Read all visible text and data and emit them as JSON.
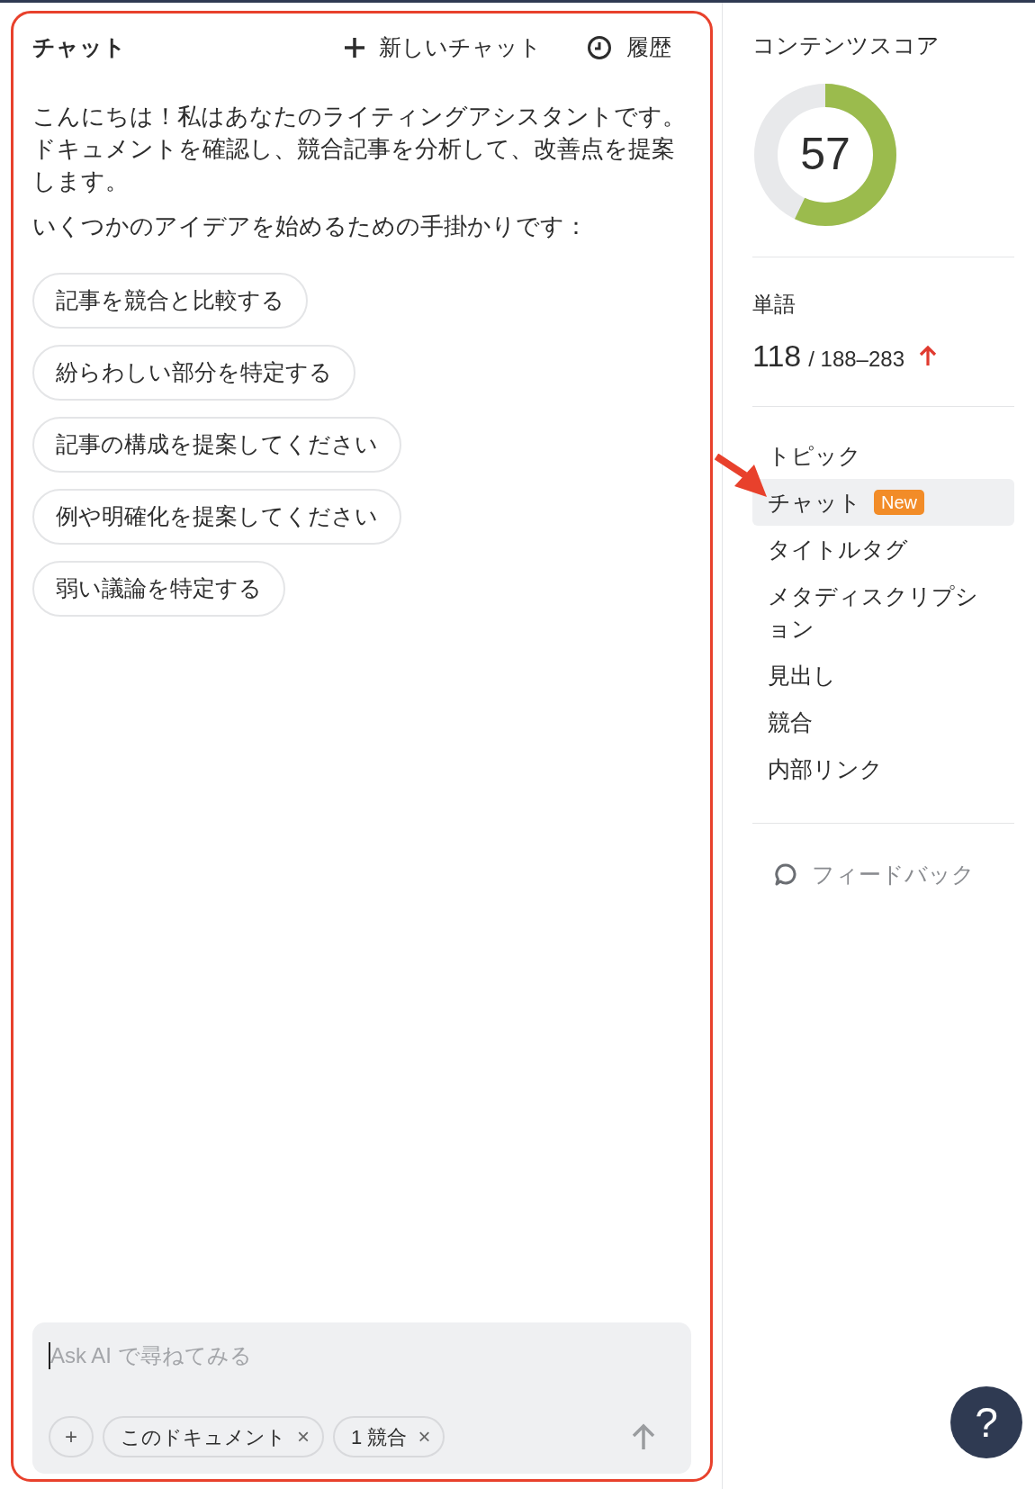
{
  "chat_panel": {
    "title": "チャット",
    "new_chat_button": "新しいチャット",
    "history_button": "履歴",
    "messages": [
      "こんにちは！私はあなたのライティングアシスタントです。ドキュメントを確認し、競合記事を分析して、改善点を提案します。",
      "いくつかのアイデアを始めるための手掛かりです："
    ],
    "suggestions": [
      "記事を競合と比較する",
      "紛らわしい部分を特定する",
      "記事の構成を提案してください",
      "例や明確化を提案してください",
      "弱い議論を特定する"
    ],
    "input": {
      "placeholder": "Ask AI で尋ねてみる",
      "add_button": "+",
      "context_chips": [
        {
          "label": "このドキュメント",
          "remove": "×"
        },
        {
          "label": "1 競合",
          "remove": "×"
        }
      ]
    }
  },
  "sidebar": {
    "content_score": {
      "title": "コンテンツスコア",
      "score": "57",
      "level": 0.57
    },
    "words": {
      "label": "単語",
      "count": "118",
      "range": "/ 188–283",
      "rising": true
    },
    "nav_items": [
      {
        "label": "トピック",
        "selected": false
      },
      {
        "label": "チャット",
        "selected": true,
        "badge": "New"
      },
      {
        "label": "タイトルタグ",
        "selected": false
      },
      {
        "label": "メタディスクリプション",
        "selected": false
      },
      {
        "label": "見出し",
        "selected": false
      },
      {
        "label": "競合",
        "selected": false
      },
      {
        "label": "内部リンク",
        "selected": false
      }
    ],
    "feedback": "フィードバック"
  },
  "help_button": "?"
}
